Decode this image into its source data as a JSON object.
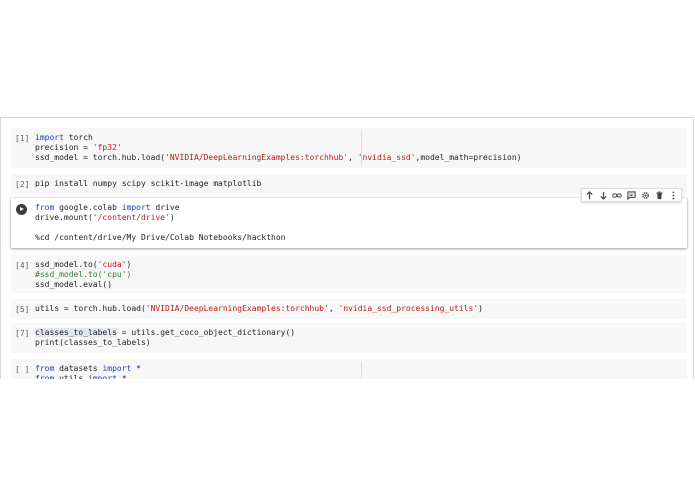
{
  "cells": [
    {
      "prompt": "[1]",
      "lines": [
        [
          {
            "t": "import",
            "c": "kw"
          },
          {
            "t": " torch",
            "c": ""
          }
        ],
        [
          {
            "t": "precision = ",
            "c": ""
          },
          {
            "t": "'fp32'",
            "c": "str"
          }
        ],
        [
          {
            "t": "ssd_model = torch.hub.load(",
            "c": ""
          },
          {
            "t": "'NVIDIA/DeepLearningExamples:torchhub'",
            "c": "str"
          },
          {
            "t": ", ",
            "c": ""
          },
          {
            "t": "'nvidia_ssd'",
            "c": "str"
          },
          {
            "t": ",model_math=precision)",
            "c": ""
          }
        ]
      ]
    },
    {
      "prompt": "[2]",
      "lines": [
        [
          {
            "t": "pip install numpy scipy scikit-image matplotlib",
            "c": ""
          }
        ]
      ]
    },
    {
      "prompt": "",
      "lines": [
        [
          {
            "t": "from",
            "c": "kw"
          },
          {
            "t": " google.colab ",
            "c": ""
          },
          {
            "t": "import",
            "c": "kw"
          },
          {
            "t": " drive",
            "c": ""
          }
        ],
        [
          {
            "t": "drive.mount(",
            "c": ""
          },
          {
            "t": "'/content/drive'",
            "c": "str"
          },
          {
            "t": ")",
            "c": ""
          }
        ],
        [
          {
            "t": "",
            "c": ""
          }
        ],
        [
          {
            "t": "%cd /content/drive/My Drive/Colab Notebooks/hackthon",
            "c": ""
          }
        ]
      ]
    },
    {
      "prompt": "[4]",
      "lines": [
        [
          {
            "t": "ssd_model.to(",
            "c": ""
          },
          {
            "t": "'cuda'",
            "c": "str"
          },
          {
            "t": ")",
            "c": ""
          }
        ],
        [
          {
            "t": "#ssd_model.to('cpu')",
            "c": "cmt"
          }
        ],
        [
          {
            "t": "ssd_model.eval()",
            "c": ""
          }
        ]
      ]
    },
    {
      "prompt": "[5]",
      "lines": [
        [
          {
            "t": "utils = torch.hub.load(",
            "c": ""
          },
          {
            "t": "'NVIDIA/DeepLearningExamples:torchhub'",
            "c": "str"
          },
          {
            "t": ", ",
            "c": ""
          },
          {
            "t": "'nvidia_ssd_processing_utils'",
            "c": "str"
          },
          {
            "t": ")",
            "c": ""
          }
        ]
      ]
    },
    {
      "prompt": "[7]",
      "lines": [
        [
          {
            "t": "classes_to_labels",
            "c": "hl"
          },
          {
            "t": " = utils.get_coco_object_dictionary()",
            "c": ""
          }
        ],
        [
          {
            "t": "print(classes_to_labels)",
            "c": ""
          }
        ]
      ]
    },
    {
      "prompt": "[ ]",
      "lines": [
        [
          {
            "t": "from",
            "c": "kw"
          },
          {
            "t": " datasets ",
            "c": ""
          },
          {
            "t": "import",
            "c": "kw"
          },
          {
            "t": " *",
            "c": ""
          }
        ],
        [
          {
            "t": "from",
            "c": "kw"
          },
          {
            "t": " utils ",
            "c": ""
          },
          {
            "t": "import",
            "c": "kw"
          },
          {
            "t": " *",
            "c": ""
          }
        ]
      ]
    }
  ],
  "toolbar": {
    "icons": [
      "arrow-up-icon",
      "arrow-down-icon",
      "link-icon",
      "comment-icon",
      "settings-icon",
      "delete-icon",
      "more-vert-icon"
    ]
  },
  "colors": {
    "keyword": "#1a40b0",
    "string": "#b71c1c",
    "comment": "#2e7d32",
    "cell_bg": "#f7f7f7"
  }
}
